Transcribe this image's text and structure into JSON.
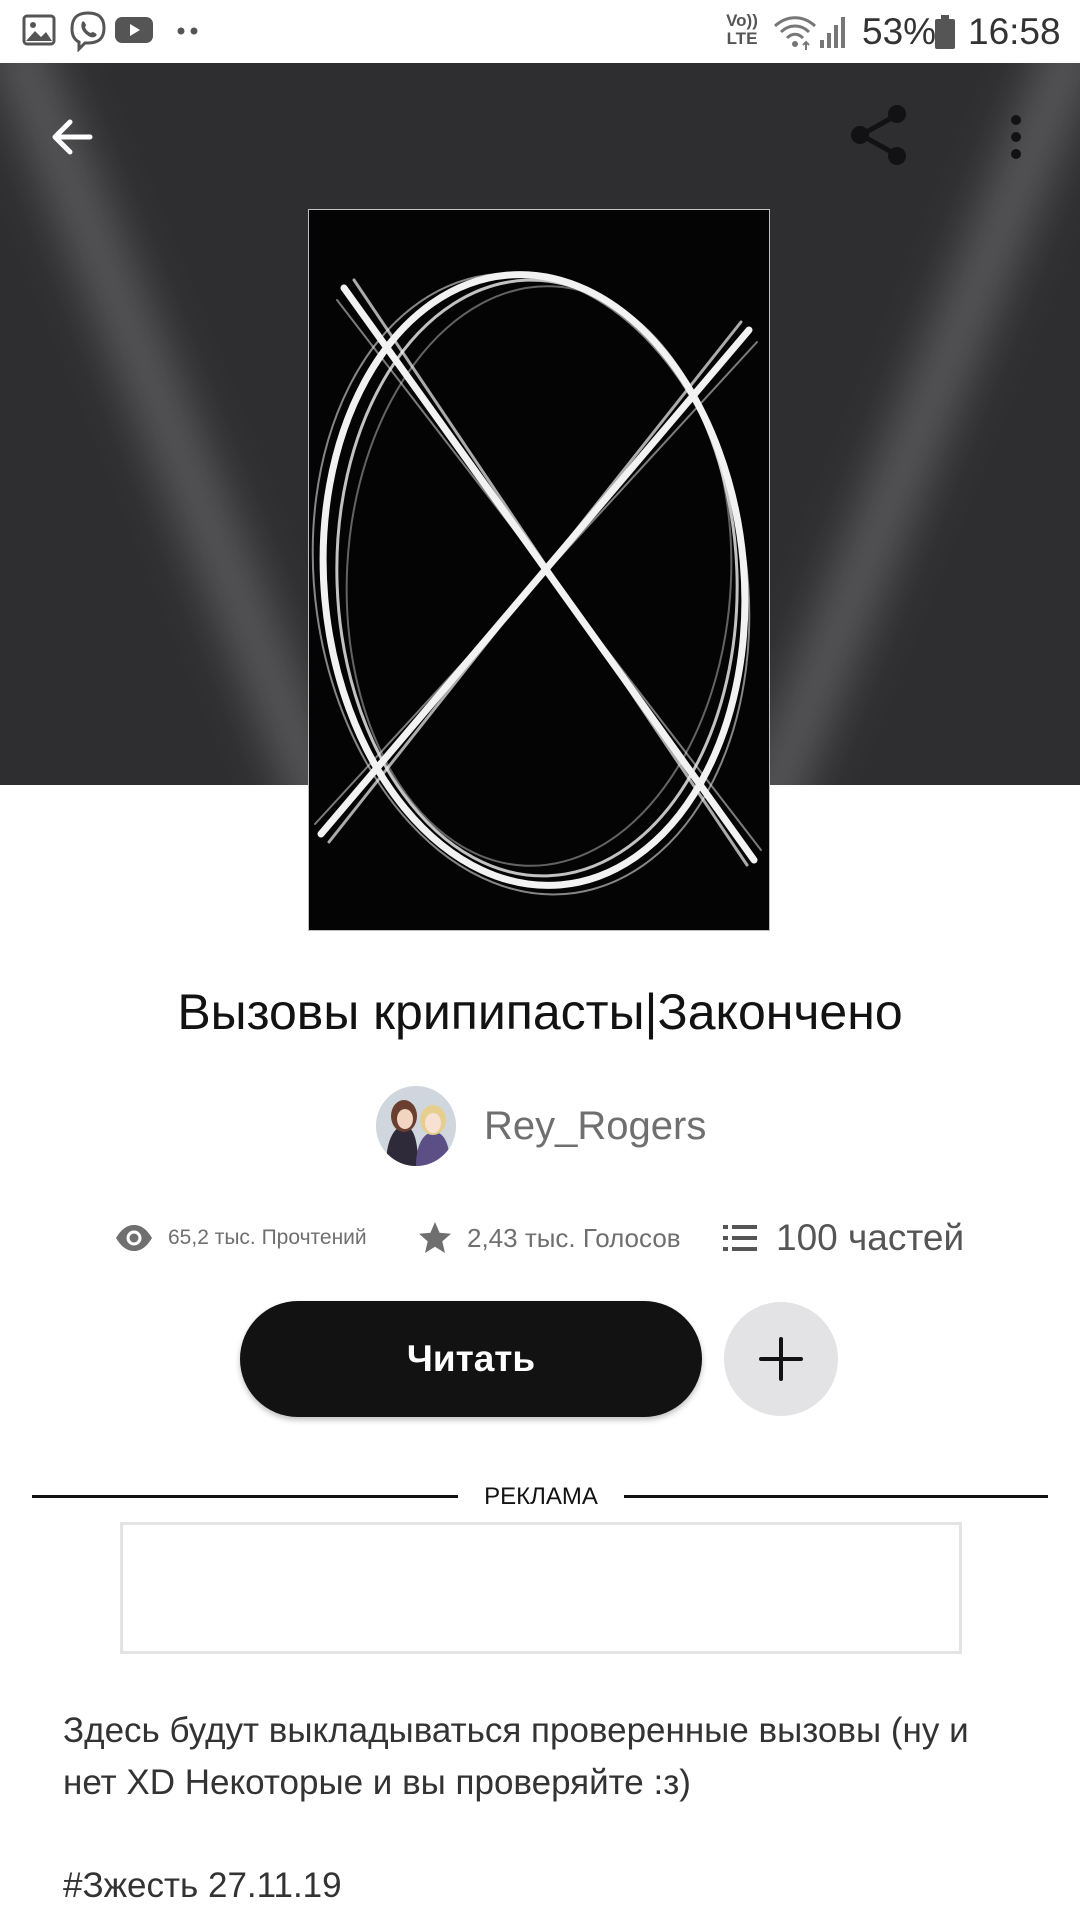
{
  "status_bar": {
    "lte_label": "Vo)) LTE",
    "battery": "53%",
    "time": "16:58",
    "icons": [
      "gallery-icon",
      "viber-icon",
      "youtube-icon",
      "more-notifications-icon",
      "wifi-icon",
      "signal-icon",
      "battery-icon"
    ]
  },
  "header": {
    "back_icon": "arrow-left-icon",
    "share_icon": "share-icon",
    "menu_icon": "more-vertical-icon",
    "background_color": "#2e2d2f"
  },
  "story": {
    "title": "Вызовы крипипасты|Закончено",
    "author": "Rey_Rogers",
    "stats": {
      "reads": "65,2 тыс. Прочтений",
      "votes": "2,43 тыс. Голосов",
      "parts": "100 частей"
    },
    "read_button": "Читать",
    "add_icon": "plus-icon",
    "ad_label": "РЕКЛАМА",
    "description": "Здесь будут выкладываться проверенные вызовы (ну и нет XD Некоторые и вы проверяйте :з)",
    "tags": "#Зжесть 27.11.19"
  },
  "colors": {
    "primary_button": "#121212",
    "secondary_button": "#e3e3e5",
    "muted_text": "#6f6f6f"
  }
}
